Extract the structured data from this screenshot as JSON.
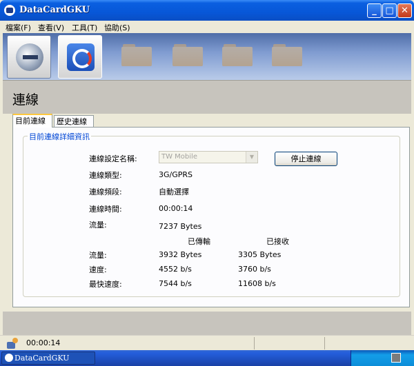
{
  "window": {
    "title": "DataCardGKU"
  },
  "menu": [
    "檔案(F)",
    "查看(V)",
    "工具(T)",
    "協助(S)"
  ],
  "page": {
    "title": "連線"
  },
  "tabs": [
    "目前連線",
    "歷史連線"
  ],
  "group": {
    "title": "目前連線詳細資訊"
  },
  "fields": {
    "profile_label": "連線設定名稱:",
    "profile_value": "TW Mobile",
    "type_label": "連線類型:",
    "type_value": "3G/GPRS",
    "band_label": "連線頻段:",
    "band_value": "自動選擇",
    "time_label": "連線時間:",
    "time_value": "00:00:14",
    "traffic_label": "流量:",
    "traffic_value": "7237 Bytes"
  },
  "disconnect_button": "停止連線",
  "stats": {
    "col_sent": "已傳輸",
    "col_received": "已接收",
    "rows": [
      {
        "label": "流量:",
        "sent": "3932 Bytes",
        "received": "3305 Bytes"
      },
      {
        "label": "速度:",
        "sent": "4552 b/s",
        "received": "3760 b/s"
      },
      {
        "label": "最快速度:",
        "sent": "7544 b/s",
        "received": "11608 b/s"
      }
    ]
  },
  "status": {
    "time": "00:00:14"
  },
  "taskbar": {
    "item": "DataCardGKU"
  },
  "colors": {
    "title_bar": "#0757d8",
    "group_title": "#0046d5",
    "tab_highlight": "#ffc73c"
  }
}
